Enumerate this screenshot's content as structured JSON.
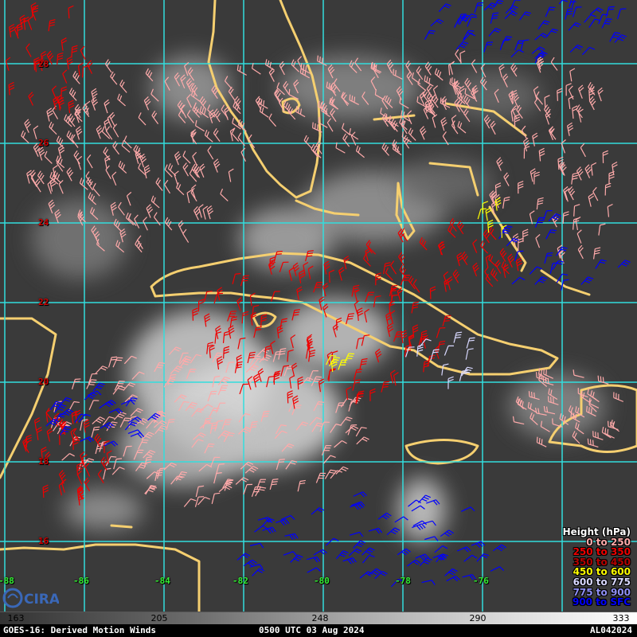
{
  "map": {
    "lat_labels": [
      "28",
      "26",
      "24",
      "22",
      "20",
      "18",
      "16"
    ],
    "lon_labels": [
      "-88",
      "-86",
      "-84",
      "-82",
      "-80",
      "-78",
      "-76"
    ],
    "grid_color": "#33dddd",
    "coast_color": "#f5cf70"
  },
  "legend": {
    "title": "Height (hPa)",
    "items": [
      {
        "label": "0 to 250",
        "color": "#ffaaaa"
      },
      {
        "label": "250 to 350",
        "color": "#ee0000"
      },
      {
        "label": "350 to 450",
        "color": "#b50000"
      },
      {
        "label": "450 to 600",
        "color": "#ffff00"
      },
      {
        "label": "600 to 775",
        "color": "#d8d8ff"
      },
      {
        "label": "775 to 900",
        "color": "#8f8ff5"
      },
      {
        "label": "900 to SFC",
        "color": "#0000ff"
      }
    ]
  },
  "colorbar": {
    "ticks": [
      "163",
      "205",
      "248",
      "290",
      "333"
    ]
  },
  "footer": {
    "left": "GOES-16: Derived Motion Winds",
    "center": "0500 UTC 03 Aug 2024",
    "right": "AL042024"
  },
  "logo": {
    "text": "CIRA",
    "color": "#3a68b8"
  }
}
